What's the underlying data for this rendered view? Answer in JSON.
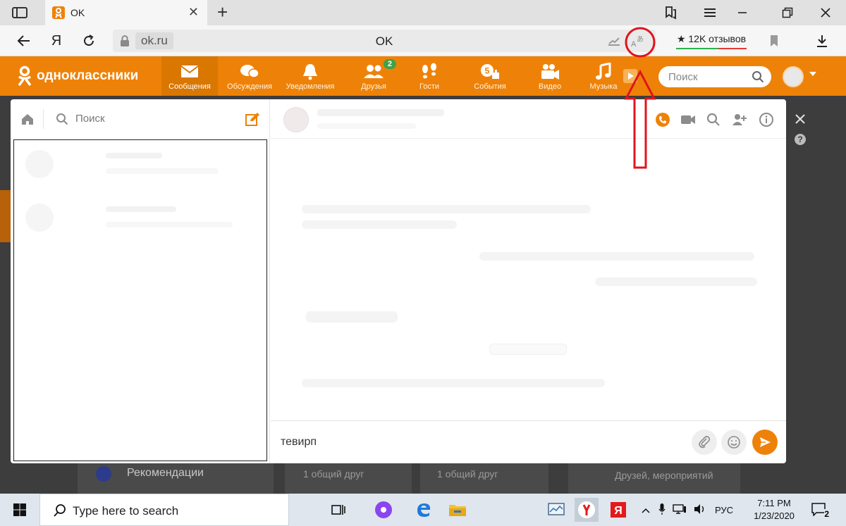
{
  "browser": {
    "tab_title": "OK",
    "tab_favicon_letter": "ok",
    "url_domain": "ok.ru",
    "page_title": "OK",
    "yandex_letter": "Я",
    "reviews_label": "★ 12K отзывов"
  },
  "ok_header": {
    "logo_text": "одноклассники",
    "nav": [
      {
        "label": "Сообщения",
        "icon": "envelope-icon"
      },
      {
        "label": "Обсуждения",
        "icon": "chat-bubbles-icon"
      },
      {
        "label": "Уведомления",
        "icon": "bell-icon"
      },
      {
        "label": "Друзья",
        "icon": "friends-icon",
        "badge": "2"
      },
      {
        "label": "Гости",
        "icon": "footprints-icon"
      },
      {
        "label": "События",
        "icon": "events-icon",
        "badge_inline": "5"
      },
      {
        "label": "Видео",
        "icon": "video-camera-icon"
      },
      {
        "label": "Музыка",
        "icon": "music-note-icon"
      }
    ],
    "search_placeholder": "Поиск"
  },
  "messenger": {
    "search_label": "Поиск",
    "composer_text": "тевирп"
  },
  "background_page": {
    "recommendations": "Рекомендации",
    "mutual_friend_1": "1 общий друг",
    "mutual_friend_2": "1 общий друг",
    "friends_events": "Друзей, мероприятий"
  },
  "taskbar": {
    "search_placeholder": "Type here to search",
    "language": "РУС",
    "time": "7:11 PM",
    "date": "1/23/2020",
    "notification_count": "2"
  },
  "colors": {
    "ok_orange": "#ee8208",
    "annotation_red": "#e0141e"
  }
}
